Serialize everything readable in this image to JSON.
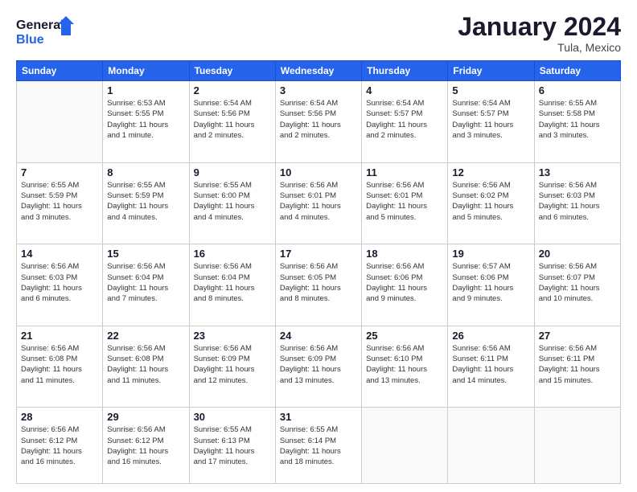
{
  "header": {
    "logo_line1": "General",
    "logo_line2": "Blue",
    "month": "January 2024",
    "location": "Tula, Mexico"
  },
  "weekdays": [
    "Sunday",
    "Monday",
    "Tuesday",
    "Wednesday",
    "Thursday",
    "Friday",
    "Saturday"
  ],
  "weeks": [
    [
      {
        "day": "",
        "info": ""
      },
      {
        "day": "1",
        "info": "Sunrise: 6:53 AM\nSunset: 5:55 PM\nDaylight: 11 hours\nand 1 minute."
      },
      {
        "day": "2",
        "info": "Sunrise: 6:54 AM\nSunset: 5:56 PM\nDaylight: 11 hours\nand 2 minutes."
      },
      {
        "day": "3",
        "info": "Sunrise: 6:54 AM\nSunset: 5:56 PM\nDaylight: 11 hours\nand 2 minutes."
      },
      {
        "day": "4",
        "info": "Sunrise: 6:54 AM\nSunset: 5:57 PM\nDaylight: 11 hours\nand 2 minutes."
      },
      {
        "day": "5",
        "info": "Sunrise: 6:54 AM\nSunset: 5:57 PM\nDaylight: 11 hours\nand 3 minutes."
      },
      {
        "day": "6",
        "info": "Sunrise: 6:55 AM\nSunset: 5:58 PM\nDaylight: 11 hours\nand 3 minutes."
      }
    ],
    [
      {
        "day": "7",
        "info": "Sunrise: 6:55 AM\nSunset: 5:59 PM\nDaylight: 11 hours\nand 3 minutes."
      },
      {
        "day": "8",
        "info": "Sunrise: 6:55 AM\nSunset: 5:59 PM\nDaylight: 11 hours\nand 4 minutes."
      },
      {
        "day": "9",
        "info": "Sunrise: 6:55 AM\nSunset: 6:00 PM\nDaylight: 11 hours\nand 4 minutes."
      },
      {
        "day": "10",
        "info": "Sunrise: 6:56 AM\nSunset: 6:01 PM\nDaylight: 11 hours\nand 4 minutes."
      },
      {
        "day": "11",
        "info": "Sunrise: 6:56 AM\nSunset: 6:01 PM\nDaylight: 11 hours\nand 5 minutes."
      },
      {
        "day": "12",
        "info": "Sunrise: 6:56 AM\nSunset: 6:02 PM\nDaylight: 11 hours\nand 5 minutes."
      },
      {
        "day": "13",
        "info": "Sunrise: 6:56 AM\nSunset: 6:03 PM\nDaylight: 11 hours\nand 6 minutes."
      }
    ],
    [
      {
        "day": "14",
        "info": "Sunrise: 6:56 AM\nSunset: 6:03 PM\nDaylight: 11 hours\nand 6 minutes."
      },
      {
        "day": "15",
        "info": "Sunrise: 6:56 AM\nSunset: 6:04 PM\nDaylight: 11 hours\nand 7 minutes."
      },
      {
        "day": "16",
        "info": "Sunrise: 6:56 AM\nSunset: 6:04 PM\nDaylight: 11 hours\nand 8 minutes."
      },
      {
        "day": "17",
        "info": "Sunrise: 6:56 AM\nSunset: 6:05 PM\nDaylight: 11 hours\nand 8 minutes."
      },
      {
        "day": "18",
        "info": "Sunrise: 6:56 AM\nSunset: 6:06 PM\nDaylight: 11 hours\nand 9 minutes."
      },
      {
        "day": "19",
        "info": "Sunrise: 6:57 AM\nSunset: 6:06 PM\nDaylight: 11 hours\nand 9 minutes."
      },
      {
        "day": "20",
        "info": "Sunrise: 6:56 AM\nSunset: 6:07 PM\nDaylight: 11 hours\nand 10 minutes."
      }
    ],
    [
      {
        "day": "21",
        "info": "Sunrise: 6:56 AM\nSunset: 6:08 PM\nDaylight: 11 hours\nand 11 minutes."
      },
      {
        "day": "22",
        "info": "Sunrise: 6:56 AM\nSunset: 6:08 PM\nDaylight: 11 hours\nand 11 minutes."
      },
      {
        "day": "23",
        "info": "Sunrise: 6:56 AM\nSunset: 6:09 PM\nDaylight: 11 hours\nand 12 minutes."
      },
      {
        "day": "24",
        "info": "Sunrise: 6:56 AM\nSunset: 6:09 PM\nDaylight: 11 hours\nand 13 minutes."
      },
      {
        "day": "25",
        "info": "Sunrise: 6:56 AM\nSunset: 6:10 PM\nDaylight: 11 hours\nand 13 minutes."
      },
      {
        "day": "26",
        "info": "Sunrise: 6:56 AM\nSunset: 6:11 PM\nDaylight: 11 hours\nand 14 minutes."
      },
      {
        "day": "27",
        "info": "Sunrise: 6:56 AM\nSunset: 6:11 PM\nDaylight: 11 hours\nand 15 minutes."
      }
    ],
    [
      {
        "day": "28",
        "info": "Sunrise: 6:56 AM\nSunset: 6:12 PM\nDaylight: 11 hours\nand 16 minutes."
      },
      {
        "day": "29",
        "info": "Sunrise: 6:56 AM\nSunset: 6:12 PM\nDaylight: 11 hours\nand 16 minutes."
      },
      {
        "day": "30",
        "info": "Sunrise: 6:55 AM\nSunset: 6:13 PM\nDaylight: 11 hours\nand 17 minutes."
      },
      {
        "day": "31",
        "info": "Sunrise: 6:55 AM\nSunset: 6:14 PM\nDaylight: 11 hours\nand 18 minutes."
      },
      {
        "day": "",
        "info": ""
      },
      {
        "day": "",
        "info": ""
      },
      {
        "day": "",
        "info": ""
      }
    ]
  ]
}
